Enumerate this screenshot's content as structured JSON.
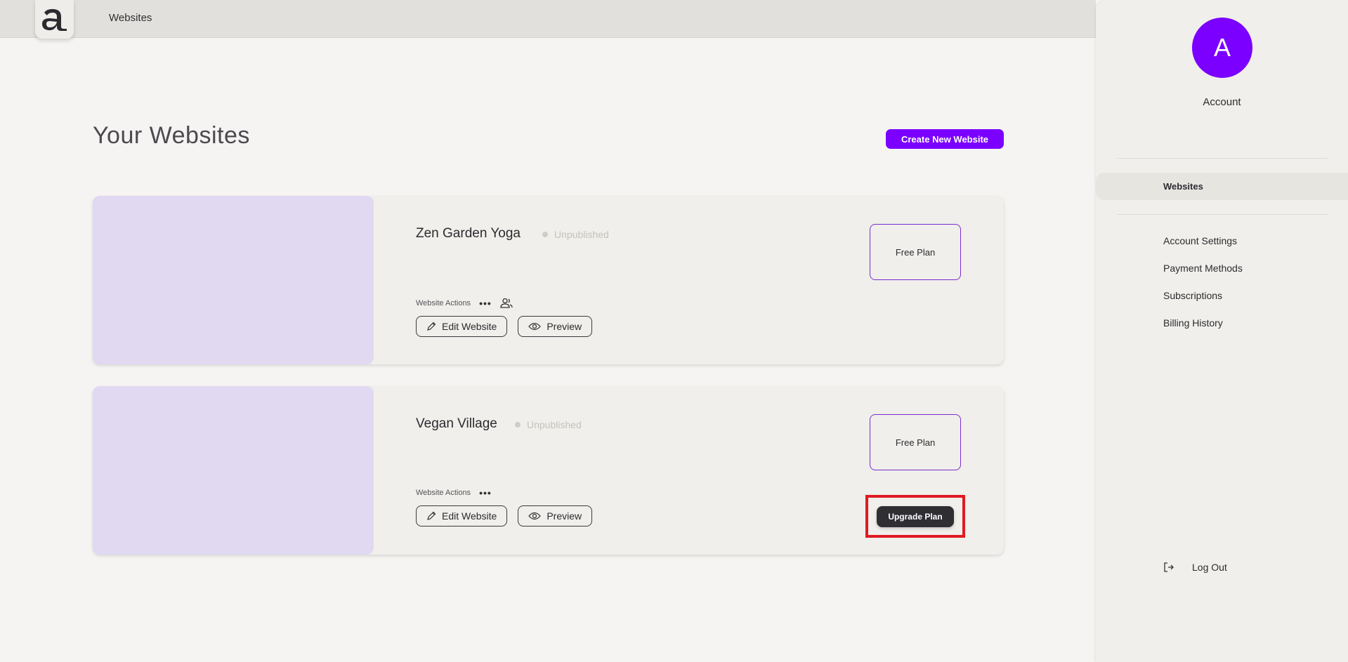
{
  "topbar": {
    "logo_letter": "a",
    "title": "Websites"
  },
  "main": {
    "page_title": "Your Websites",
    "create_button": "Create New Website",
    "website_actions_label": "Website Actions",
    "edit_label": "Edit Website",
    "preview_label": "Preview",
    "websites": [
      {
        "name": "Zen Garden Yoga",
        "status": "Unpublished",
        "plan": "Free Plan",
        "show_collaborators_icon": true,
        "upgrade_label": null
      },
      {
        "name": "Vegan Village",
        "status": "Unpublished",
        "plan": "Free Plan",
        "show_collaborators_icon": false,
        "upgrade_label": "Upgrade Plan"
      }
    ]
  },
  "sidebar": {
    "avatar_initial": "A",
    "account_label": "Account",
    "active_item": "Websites",
    "items": [
      {
        "label": "Account Settings"
      },
      {
        "label": "Payment Methods"
      },
      {
        "label": "Subscriptions"
      },
      {
        "label": "Billing History"
      }
    ],
    "logout_label": "Log Out"
  },
  "colors": {
    "brand": "#7b00ff",
    "thumbnail": "#e1d8f2",
    "highlight": "#e01a22"
  }
}
